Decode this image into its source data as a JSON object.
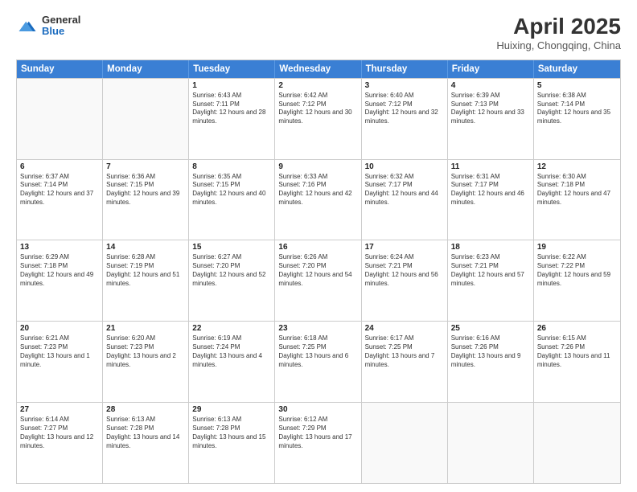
{
  "logo": {
    "general": "General",
    "blue": "Blue"
  },
  "title": "April 2025",
  "subtitle": "Huixing, Chongqing, China",
  "days": [
    "Sunday",
    "Monday",
    "Tuesday",
    "Wednesday",
    "Thursday",
    "Friday",
    "Saturday"
  ],
  "weeks": [
    [
      {
        "day": "",
        "info": ""
      },
      {
        "day": "",
        "info": ""
      },
      {
        "day": "1",
        "info": "Sunrise: 6:43 AM\nSunset: 7:11 PM\nDaylight: 12 hours and 28 minutes."
      },
      {
        "day": "2",
        "info": "Sunrise: 6:42 AM\nSunset: 7:12 PM\nDaylight: 12 hours and 30 minutes."
      },
      {
        "day": "3",
        "info": "Sunrise: 6:40 AM\nSunset: 7:12 PM\nDaylight: 12 hours and 32 minutes."
      },
      {
        "day": "4",
        "info": "Sunrise: 6:39 AM\nSunset: 7:13 PM\nDaylight: 12 hours and 33 minutes."
      },
      {
        "day": "5",
        "info": "Sunrise: 6:38 AM\nSunset: 7:14 PM\nDaylight: 12 hours and 35 minutes."
      }
    ],
    [
      {
        "day": "6",
        "info": "Sunrise: 6:37 AM\nSunset: 7:14 PM\nDaylight: 12 hours and 37 minutes."
      },
      {
        "day": "7",
        "info": "Sunrise: 6:36 AM\nSunset: 7:15 PM\nDaylight: 12 hours and 39 minutes."
      },
      {
        "day": "8",
        "info": "Sunrise: 6:35 AM\nSunset: 7:15 PM\nDaylight: 12 hours and 40 minutes."
      },
      {
        "day": "9",
        "info": "Sunrise: 6:33 AM\nSunset: 7:16 PM\nDaylight: 12 hours and 42 minutes."
      },
      {
        "day": "10",
        "info": "Sunrise: 6:32 AM\nSunset: 7:17 PM\nDaylight: 12 hours and 44 minutes."
      },
      {
        "day": "11",
        "info": "Sunrise: 6:31 AM\nSunset: 7:17 PM\nDaylight: 12 hours and 46 minutes."
      },
      {
        "day": "12",
        "info": "Sunrise: 6:30 AM\nSunset: 7:18 PM\nDaylight: 12 hours and 47 minutes."
      }
    ],
    [
      {
        "day": "13",
        "info": "Sunrise: 6:29 AM\nSunset: 7:18 PM\nDaylight: 12 hours and 49 minutes."
      },
      {
        "day": "14",
        "info": "Sunrise: 6:28 AM\nSunset: 7:19 PM\nDaylight: 12 hours and 51 minutes."
      },
      {
        "day": "15",
        "info": "Sunrise: 6:27 AM\nSunset: 7:20 PM\nDaylight: 12 hours and 52 minutes."
      },
      {
        "day": "16",
        "info": "Sunrise: 6:26 AM\nSunset: 7:20 PM\nDaylight: 12 hours and 54 minutes."
      },
      {
        "day": "17",
        "info": "Sunrise: 6:24 AM\nSunset: 7:21 PM\nDaylight: 12 hours and 56 minutes."
      },
      {
        "day": "18",
        "info": "Sunrise: 6:23 AM\nSunset: 7:21 PM\nDaylight: 12 hours and 57 minutes."
      },
      {
        "day": "19",
        "info": "Sunrise: 6:22 AM\nSunset: 7:22 PM\nDaylight: 12 hours and 59 minutes."
      }
    ],
    [
      {
        "day": "20",
        "info": "Sunrise: 6:21 AM\nSunset: 7:23 PM\nDaylight: 13 hours and 1 minute."
      },
      {
        "day": "21",
        "info": "Sunrise: 6:20 AM\nSunset: 7:23 PM\nDaylight: 13 hours and 2 minutes."
      },
      {
        "day": "22",
        "info": "Sunrise: 6:19 AM\nSunset: 7:24 PM\nDaylight: 13 hours and 4 minutes."
      },
      {
        "day": "23",
        "info": "Sunrise: 6:18 AM\nSunset: 7:25 PM\nDaylight: 13 hours and 6 minutes."
      },
      {
        "day": "24",
        "info": "Sunrise: 6:17 AM\nSunset: 7:25 PM\nDaylight: 13 hours and 7 minutes."
      },
      {
        "day": "25",
        "info": "Sunrise: 6:16 AM\nSunset: 7:26 PM\nDaylight: 13 hours and 9 minutes."
      },
      {
        "day": "26",
        "info": "Sunrise: 6:15 AM\nSunset: 7:26 PM\nDaylight: 13 hours and 11 minutes."
      }
    ],
    [
      {
        "day": "27",
        "info": "Sunrise: 6:14 AM\nSunset: 7:27 PM\nDaylight: 13 hours and 12 minutes."
      },
      {
        "day": "28",
        "info": "Sunrise: 6:13 AM\nSunset: 7:28 PM\nDaylight: 13 hours and 14 minutes."
      },
      {
        "day": "29",
        "info": "Sunrise: 6:13 AM\nSunset: 7:28 PM\nDaylight: 13 hours and 15 minutes."
      },
      {
        "day": "30",
        "info": "Sunrise: 6:12 AM\nSunset: 7:29 PM\nDaylight: 13 hours and 17 minutes."
      },
      {
        "day": "",
        "info": ""
      },
      {
        "day": "",
        "info": ""
      },
      {
        "day": "",
        "info": ""
      }
    ]
  ]
}
